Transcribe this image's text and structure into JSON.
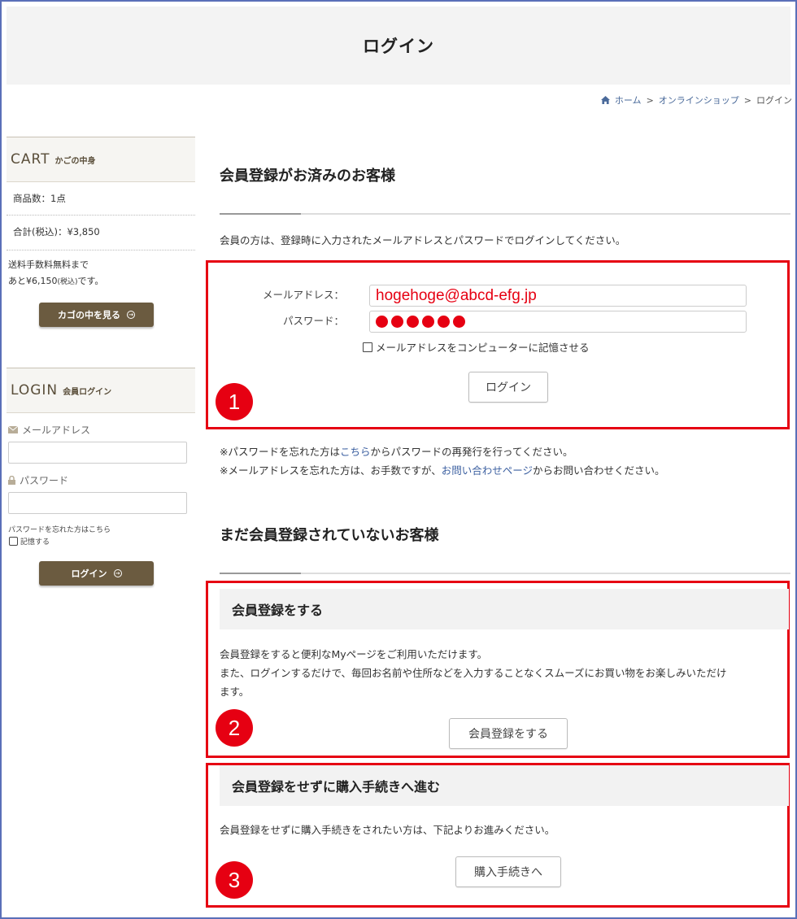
{
  "header": {
    "title": "ログイン"
  },
  "breadcrumb": {
    "home": "ホーム",
    "sep": ">",
    "shop": "オンラインショップ",
    "current": "ログイン"
  },
  "sidebar": {
    "cart": {
      "title": "CART",
      "subtitle": "かごの中身",
      "item_count": "商品数：1点",
      "total": "合計(税込)：¥3,850",
      "shipping_line1": "送料手数料無料まで",
      "shipping_prefix": "あと¥6,150",
      "shipping_tax": "(税込)",
      "shipping_suffix": "です。",
      "button": "カゴの中を見る"
    },
    "login": {
      "title": "LOGIN",
      "subtitle": "会員ログイン",
      "email_label": "メールアドレス",
      "password_label": "パスワード",
      "forgot": "パスワードを忘れた方はこちら",
      "remember": "記憶する",
      "button": "ログイン"
    }
  },
  "main": {
    "member": {
      "title": "会員登録がお済みのお客様",
      "intro": "会員の方は、登録時に入力されたメールアドレスとパスワードでログインしてください。",
      "email_label": "メールアドレス：",
      "email_value": "hogehoge@abcd-efg.jp",
      "password_label": "パスワード：",
      "password_dots": 6,
      "remember": "メールアドレスをコンピューターに記憶させる",
      "button": "ログイン",
      "badge": "1",
      "forgot_pw_prefix": "※パスワードを忘れた方は",
      "forgot_pw_link": "こちら",
      "forgot_pw_suffix": "からパスワードの再発行を行ってください。",
      "forgot_email_prefix": "※メールアドレスを忘れた方は、お手数ですが、",
      "forgot_email_link": "お問い合わせページ",
      "forgot_email_suffix": "からお問い合わせください。"
    },
    "guest": {
      "title": "まだ会員登録されていないお客様",
      "register": {
        "heading": "会員登録をする",
        "line1": "会員登録をすると便利なMyページをご利用いただけます。",
        "line2": "また、ログインするだけで、毎回お名前や住所などを入力することなくスムーズにお買い物をお楽しみいただけ",
        "line3": "ます。",
        "button": "会員登録をする",
        "badge": "2"
      },
      "checkout": {
        "heading": "会員登録をせずに購入手続きへ進む",
        "text": "会員登録をせずに購入手続きをされたい方は、下記よりお進みください。",
        "button": "購入手続きへ",
        "badge": "3"
      }
    }
  },
  "colors": {
    "accent_red": "#e60012",
    "brown_button": "#6b5b40",
    "link_blue": "#3b5fa0"
  }
}
